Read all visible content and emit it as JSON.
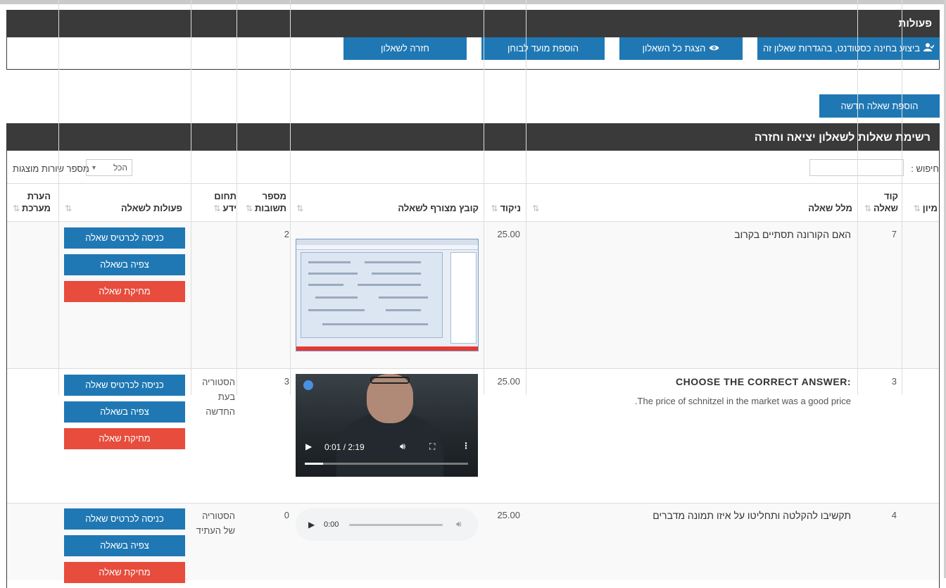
{
  "actions_panel": {
    "title": "פעולות",
    "buttons": [
      {
        "label": "ביצוע בחינה כסטודנט, בהגדרות שאלון זה",
        "icon": "user-icon"
      },
      {
        "label": "הצגת כל השאלון",
        "icon": "eye-icon"
      },
      {
        "label": "הוספת מועד לבוחן"
      },
      {
        "label": "חזרה לשאלון"
      }
    ]
  },
  "add_question_label": "הוספת שאלה חדשה",
  "questions_panel": {
    "title": "רשימת שאלות לשאלון יציאה וחזרה",
    "search_label": "חיפוש :",
    "search_value": "",
    "length_label": "מספר שורות מוצגות",
    "length_value": "הכל"
  },
  "table": {
    "headers": {
      "sort": "מיון",
      "code": "קוד שאלה",
      "stem": "מלל שאלה",
      "score": "ניקוד",
      "file": "קובץ מצורף לשאלה",
      "answers": "מספר תשובות",
      "field": "תחום ידע",
      "actions": "פעולות לשאלה",
      "note": "הערת מערכת"
    },
    "sort_icon": "⇅",
    "rows": [
      {
        "code": "7",
        "title": "האם הקורונה תסתיים בקרוב",
        "subtitle": "",
        "score": "25.00",
        "attachment": "screenshot",
        "answers": "2",
        "field": "",
        "buttons": [
          "כניסה לכרטיס שאלה",
          "צפיה בשאלה",
          "מחיקת שאלה"
        ]
      },
      {
        "code": "3",
        "title": ":CHOOSE THE CORRECT ANSWER",
        "subtitle": ".The price of schnitzel in the market was a good price",
        "score": "25.00",
        "attachment": "video",
        "video_time": "0:01 / 2:19",
        "video_progress": 0.11,
        "answers": "3",
        "field": "הסטוריה בעת החדשה",
        "buttons": [
          "כניסה לכרטיס שאלה",
          "צפיה בשאלה",
          "מחיקת שאלה"
        ]
      },
      {
        "code": "4",
        "title": "תקשיבו להקלטה ותחליטו על איזו תמונה מדברים",
        "subtitle": "",
        "score": "25.00",
        "attachment": "audio",
        "audio_time": "0:00",
        "answers": "0",
        "field": "הסטוריה של העתיד",
        "buttons": [
          "כניסה לכרטיס שאלה",
          "צפיה בשאלה",
          "מחיקת שאלה"
        ]
      }
    ]
  },
  "colors": {
    "header_bg": "#3a3a3a",
    "primary": "#1f78b4",
    "danger": "#e74c3c"
  }
}
